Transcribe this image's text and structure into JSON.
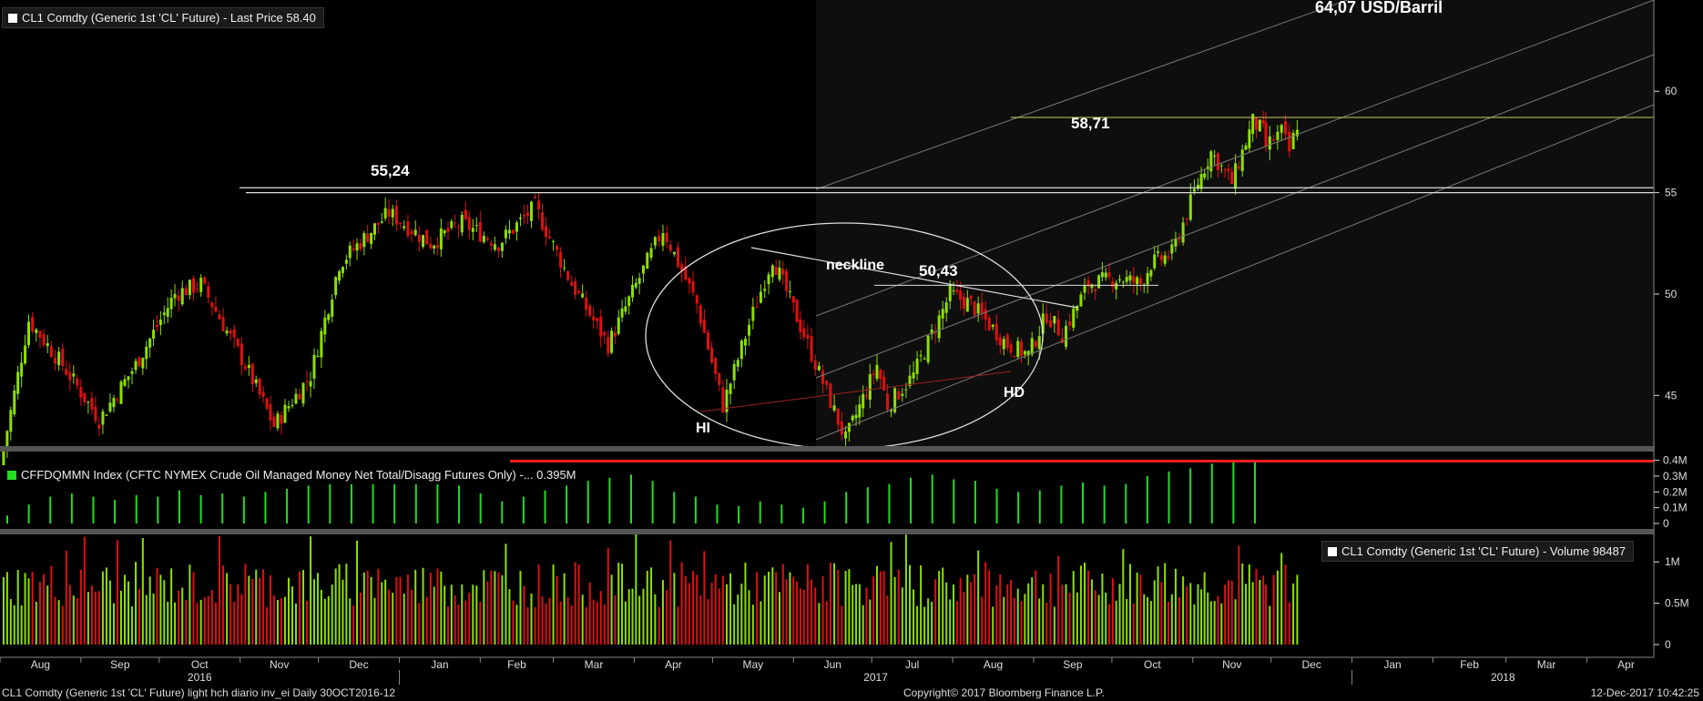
{
  "header": {
    "legend_price": "CL1 Comdty (Generic 1st 'CL' Future) - Last Price 58.40",
    "legend_cftc": "CFFDQMMN Index (CFTC NYMEX Crude Oil Managed Money Net Total/Disagg Futures Only) -... 0.395M",
    "legend_volume": "CL1 Comdty (Generic 1st 'CL' Future) - Volume 98487"
  },
  "footer": {
    "left": "CL1 Comdty (Generic 1st 'CL' Future) light hch diario inv_ei  Daily 30OCT2016-12",
    "center": "Copyright© 2017 Bloomberg Finance L.P.",
    "right": "12-Dec-2017 10:42:25"
  },
  "colors": {
    "background": "#000000",
    "up": "#8ee000",
    "down": "#e01010",
    "cftc": "#22dd22",
    "cftc_line": "#ff2020",
    "axis_text": "#dddddd"
  },
  "chart_data": [
    {
      "type": "candlestick",
      "name": "CL1 Comdty Last Price",
      "ylim": [
        42.5,
        64.5
      ],
      "yticks": [
        45,
        50,
        55,
        60
      ],
      "months": [
        "Aug",
        "Sep",
        "Oct",
        "Nov",
        "Dec",
        "Jan",
        "Feb",
        "Mar",
        "Apr",
        "May",
        "Jun",
        "Jul",
        "Aug",
        "Sep",
        "Oct",
        "Nov",
        "Dec",
        "Jan",
        "Feb",
        "Mar",
        "Apr"
      ],
      "years": [
        "2016",
        "2017",
        "2018"
      ],
      "close_path": [
        [
          "2016-08-01",
          41.5
        ],
        [
          "2016-08-12",
          48.7
        ],
        [
          "2016-08-25",
          46.5
        ],
        [
          "2016-09-08",
          43.8
        ],
        [
          "2016-09-22",
          46.5
        ],
        [
          "2016-10-07",
          50.0
        ],
        [
          "2016-10-17",
          50.5
        ],
        [
          "2016-11-03",
          46.5
        ],
        [
          "2016-11-14",
          43.5
        ],
        [
          "2016-11-28",
          46.0
        ],
        [
          "2016-12-09",
          51.5
        ],
        [
          "2016-12-28",
          54.0
        ],
        [
          "2017-01-13",
          52.5
        ],
        [
          "2017-01-25",
          53.5
        ],
        [
          "2017-02-08",
          52.5
        ],
        [
          "2017-02-22",
          54.3
        ],
        [
          "2017-03-08",
          50.5
        ],
        [
          "2017-03-22",
          47.5
        ],
        [
          "2017-04-03",
          50.8
        ],
        [
          "2017-04-12",
          53.2
        ],
        [
          "2017-04-25",
          49.5
        ],
        [
          "2017-05-05",
          44.5
        ],
        [
          "2017-05-15",
          48.5
        ],
        [
          "2017-05-24",
          51.8
        ],
        [
          "2017-06-05",
          48.0
        ],
        [
          "2017-06-21",
          42.8
        ],
        [
          "2017-07-03",
          46.5
        ],
        [
          "2017-07-07",
          44.5
        ],
        [
          "2017-07-17",
          46.0
        ],
        [
          "2017-07-31",
          50.0
        ],
        [
          "2017-08-08",
          49.5
        ],
        [
          "2017-08-22",
          47.5
        ],
        [
          "2017-08-30",
          47.0
        ],
        [
          "2017-09-06",
          49.0
        ],
        [
          "2017-09-12",
          48.0
        ],
        [
          "2017-09-22",
          50.5
        ],
        [
          "2017-10-04",
          50.8
        ],
        [
          "2017-10-12",
          50.5
        ],
        [
          "2017-10-16",
          51.5
        ],
        [
          "2017-10-24",
          52.0
        ],
        [
          "2017-11-03",
          55.5
        ],
        [
          "2017-11-08",
          57.0
        ],
        [
          "2017-11-16",
          55.5
        ],
        [
          "2017-11-24",
          58.5
        ],
        [
          "2017-11-28",
          58.0
        ],
        [
          "2017-11-29",
          57.3
        ],
        [
          "2017-12-05",
          58.0
        ],
        [
          "2017-12-08",
          57.0
        ],
        [
          "2017-12-11",
          58.4
        ]
      ],
      "annotations": [
        "64,07 USD/Barril",
        "58,71",
        "55,24",
        "50,43",
        "neckline",
        "HI",
        "HD"
      ],
      "levels": [
        55.24,
        55.0,
        58.71,
        50.43
      ]
    },
    {
      "type": "bar",
      "name": "CFFDQMMN Index",
      "ylim": [
        0,
        0.45
      ],
      "yticks": [
        "0.4M",
        "0.3M",
        "0.2M",
        "0.1M",
        "0"
      ],
      "values": [
        0.05,
        0.12,
        0.17,
        0.19,
        0.17,
        0.15,
        0.18,
        0.17,
        0.21,
        0.18,
        0.19,
        0.17,
        0.2,
        0.22,
        0.24,
        0.25,
        0.28,
        0.3,
        0.31,
        0.31,
        0.25,
        0.24,
        0.19,
        0.14,
        0.17,
        0.21,
        0.24,
        0.27,
        0.29,
        0.31,
        0.27,
        0.2,
        0.17,
        0.12,
        0.11,
        0.14,
        0.12,
        0.1,
        0.14,
        0.2,
        0.23,
        0.25,
        0.29,
        0.31,
        0.28,
        0.27,
        0.22,
        0.2,
        0.21,
        0.24,
        0.26,
        0.24,
        0.25,
        0.3,
        0.33,
        0.35,
        0.38,
        0.4,
        0.4
      ],
      "current": 0.395
    },
    {
      "type": "bar",
      "name": "CL1 Comdty Volume",
      "ylim": [
        0,
        1.3
      ],
      "yticks": [
        "1M",
        "0.5M",
        "0"
      ],
      "last": 98487
    }
  ]
}
